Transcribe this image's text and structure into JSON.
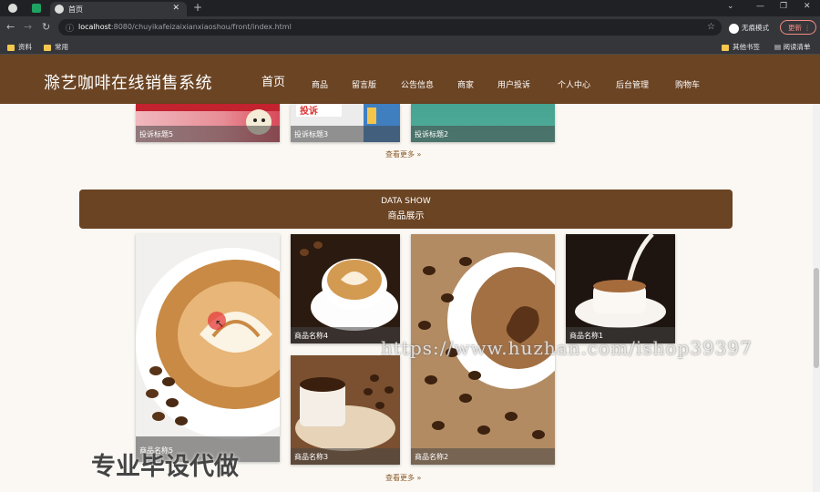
{
  "browser": {
    "tab_title": "首页",
    "url_host": "localhost",
    "url_rest": ":8080/chuyikafeizaixianxiaoshou/front/index.html",
    "incognito_label": "无痕模式",
    "update_label": "更新",
    "bookmarks": [
      "资料",
      "常用"
    ],
    "other_bookmarks": "其他书签",
    "reading_list": "阅读清单"
  },
  "header": {
    "site_title": "滁艺咖啡在线销售系统",
    "menu": [
      "首页",
      "商品",
      "留言版",
      "公告信息",
      "商家",
      "用户投诉",
      "个人中心",
      "后台管理",
      "购物车"
    ]
  },
  "complaints": {
    "items": [
      "投诉标题5",
      "投诉标题3",
      "投诉标题2"
    ],
    "more_label": "查看更多"
  },
  "products_section": {
    "title_en": "DATA SHOW",
    "title_cn": "商品展示",
    "items": [
      "商品名称5",
      "商品名称4",
      "商品名称3",
      "商品名称2",
      "商品名称1"
    ],
    "more_label": "查看更多"
  },
  "overlay": {
    "watermark": "https://www.huzhan.com/ishop39397",
    "promo": "专业毕设代做"
  },
  "colors": {
    "brand": "#6b4423",
    "link": "#8a5a2b"
  }
}
